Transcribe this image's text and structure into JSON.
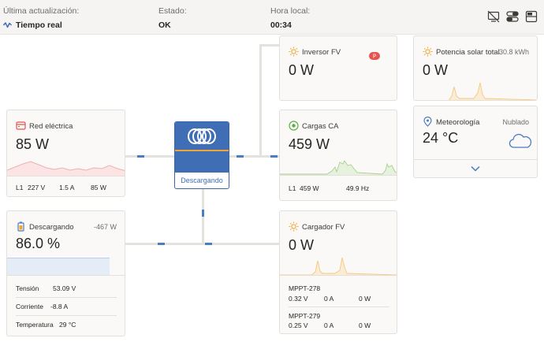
{
  "header": {
    "last_update_label": "Última actualización:",
    "last_update_value": "Tiempo real",
    "status_label": "Estado:",
    "status_value": "OK",
    "local_time_label": "Hora local:",
    "local_time_value": "00:34"
  },
  "grid": {
    "title": "Red eléctrica",
    "power": "85 W",
    "phase": "L1",
    "voltage": "227 V",
    "current": "1.5 A",
    "phase_power": "85 W"
  },
  "battery": {
    "title": "Descargando",
    "power": "-467 W",
    "soc": "86.0 %",
    "voltage_label": "Tensión",
    "voltage": "53.09 V",
    "current_label": "Corriente",
    "current": "-8.8 A",
    "temp_label": "Temperatura",
    "temp": "29 °C",
    "soc_fraction": 0.86
  },
  "inverter": {
    "state": "Descargando"
  },
  "pv_inverter": {
    "title": "Inversor FV",
    "power": "0 W"
  },
  "ac_loads": {
    "title": "Cargas CA",
    "power": "459 W",
    "phase": "L1",
    "phase_power": "459 W",
    "frequency": "49.9 Hz"
  },
  "pv_charger": {
    "title": "Cargador FV",
    "power": "0 W",
    "mppt": [
      {
        "name": "MPPT-278",
        "voltage": "0.32 V",
        "current": "0 A",
        "power": "0 W"
      },
      {
        "name": "MPPT-279",
        "voltage": "0.25 V",
        "current": "0 A",
        "power": "0 W"
      }
    ]
  },
  "solar_total": {
    "title": "Potencia solar total",
    "energy": "30.8 kWh",
    "power": "0 W"
  },
  "weather": {
    "title": "Meteorología",
    "condition": "Nublado",
    "temp": "24 °C"
  },
  "colors": {
    "accent_blue": "#4a7cc0",
    "solar_orange": "#f0a634",
    "grid_red": "#e4554f",
    "loads_green": "#5fae45"
  }
}
